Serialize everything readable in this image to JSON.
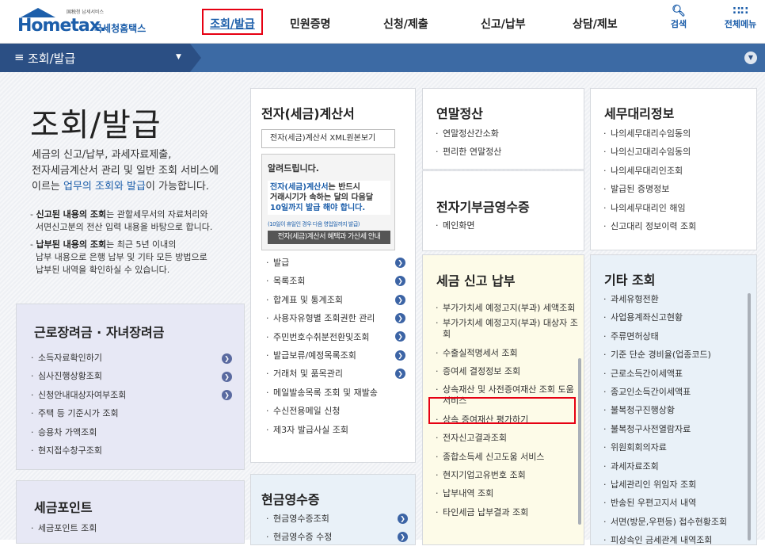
{
  "header": {
    "logo_tag": "国税청 납세서비스",
    "logo_main": "Hometax.",
    "logo_kr": "국세청홈택스",
    "nav": [
      "조회/발급",
      "민원증명",
      "신청/제출",
      "신고/납부",
      "상담/제보"
    ],
    "search_label": "검색",
    "allmenu_label": "전체메뉴"
  },
  "subbar": {
    "title": "조회/발급"
  },
  "intro": {
    "title": "조회/발급",
    "desc1": "세금의 신고/납부, 과세자료제출,",
    "desc2": "전자세금계산서 관리 및 일반 조회 서비스에",
    "desc3_pre": "이르는 ",
    "desc3_hl": "업무의 조회와 발급",
    "desc3_post": "이 가능합니다.",
    "note1_b": "신고된 내용의 조회",
    "note1_rest": "는 관할세무서의 자료처리와",
    "note1_line2": "서면신고분의 전산 입력 내용을 바탕으로 합니다.",
    "note2_b": "납부된 내용의 조회",
    "note2_rest": "는 최근 5년 이내의",
    "note2_line2": "납부 내용으로 은행 납부 및 기타 모든 방법으로",
    "note2_line3": "납부된 내역을 확인하실 수 있습니다."
  },
  "labor": {
    "title": "근로장려금 · 자녀장려금",
    "items": [
      "소득자료확인하기",
      "심사진행상황조회",
      "신청안내대상자여부조회",
      "주택 등 기준시가 조회",
      "승용차 가액조회",
      "현지접수창구조회"
    ]
  },
  "point": {
    "title": "세금포인트",
    "items": [
      "세금포인트 조회"
    ]
  },
  "einvoice": {
    "title": "전자(세금)계산서",
    "select": "전자(세금)계산서 XML원본보기",
    "notice_title": "알려드립니다.",
    "notice_l1a": "전자(세금)계산서",
    "notice_l1b": "는 반드시",
    "notice_l2": "거래시기가 속하는 달의 다음달",
    "notice_l3": "10일까지 발급 해야 합니다.",
    "notice_small": "(10일이 휴일인 경우 다음 영업일까지 발급)",
    "notice_btn": "전자(세금)계산서 혜택과 가산세 안내",
    "items": [
      "발급",
      "목록조회",
      "합계표 및 통계조회",
      "사용자유형별 조회권한 관리",
      "주민번호수취분전환및조회",
      "발급보류/예정목록조회",
      "거래처 및 품목관리",
      "메일발송목록 조회 및 재발송",
      "수신전용메일 신청",
      "제3자 발급사실 조회"
    ]
  },
  "cash": {
    "title": "현금영수증",
    "items": [
      "현금영수증조회",
      "현금영수증 수정"
    ]
  },
  "yearend": {
    "title": "연말정산",
    "items": [
      "연말정산간소화",
      "편리한 연말정산"
    ]
  },
  "donation": {
    "title": "전자기부금영수증",
    "items": [
      "메인화면"
    ]
  },
  "taxreport": {
    "title": "세금 신고 납부",
    "items": [
      "부가가치세 예정고지(부과) 세액조회",
      "부가가치세 예정고지(부과) 대상자 조회",
      "수출실적명세서 조회",
      "증여세 결정정보 조회",
      "상속재산 및 사전증여재산 조회 도움 서비스",
      "상속 증여재산 평가하기",
      "전자신고결과조회",
      "종합소득세 신고도움 서비스",
      "현지기업고유번호 조회",
      "납부내역 조회",
      "타인세금 납부결과 조회"
    ]
  },
  "agent": {
    "title": "세무대리정보",
    "items": [
      "나의세무대리수임동의",
      "나의신고대리수임동의",
      "나의세무대리인조회",
      "발급된 증명정보",
      "나의세무대리인 해임",
      "신고대리 정보이력 조회"
    ]
  },
  "etc": {
    "title": "기타 조회",
    "items": [
      "과세유형전환",
      "사업용계좌신고현황",
      "주류면허상태",
      "기준 단순 경비율(업종코드)",
      "근로소득간이세액표",
      "종교인소득간이세액표",
      "불복청구진행상황",
      "불복청구사전열람자료",
      "위원회회의자료",
      "과세자료조회",
      "납세관리인 위임자 조회",
      "반송된 우편고지서 내역",
      "서면(방문,우편등) 접수현황조회",
      "피상속인 금세관계 내역조회"
    ]
  }
}
